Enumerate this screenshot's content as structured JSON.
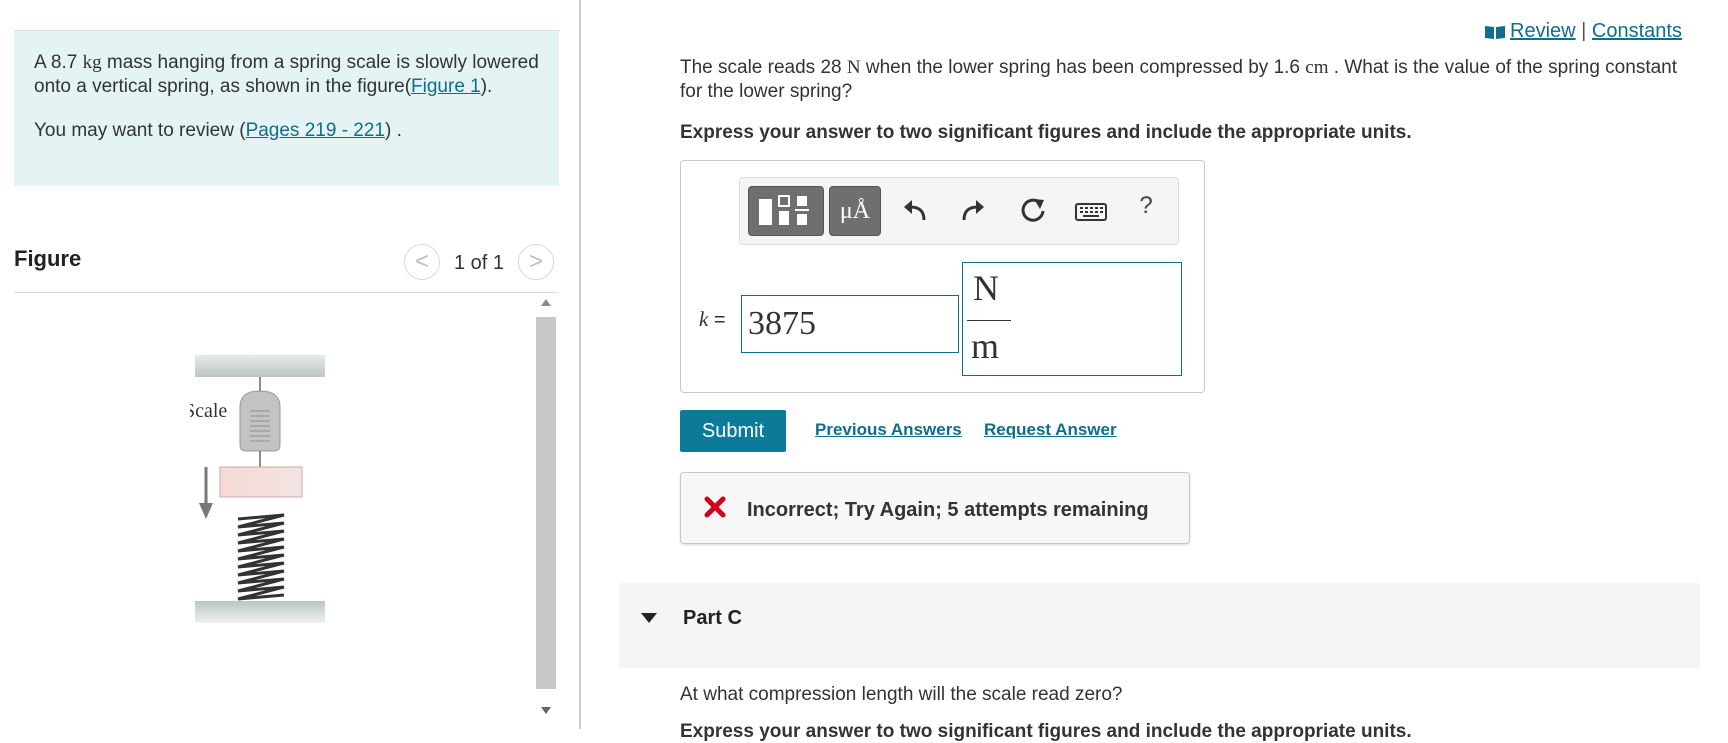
{
  "intro": {
    "text_before": "A 8.7 ",
    "mass_unit": "kg",
    "text_after": " mass hanging from a spring scale is slowly lowered onto a vertical spring, as shown in the figure(",
    "figure_link": "Figure 1",
    "close": ").",
    "review_before": "You may want to review (",
    "pages_link": "Pages 219 - 221",
    "review_after": ") ."
  },
  "figure": {
    "title": "Figure",
    "prev": "<",
    "counter": "1 of 1",
    "next": ">",
    "scale_label": "Scale",
    "icon": "spring-scale-figure"
  },
  "header_links": {
    "review": "Review",
    "separator": "|",
    "constants": "Constants"
  },
  "question": {
    "before": "The scale reads 28 ",
    "force_unit": "N",
    "middle": " when the lower spring has been compressed by 1.6 ",
    "length_unit": "cm",
    "after": " . What is the value of the spring constant for the lower spring?",
    "instruction": "Express your answer to two significant figures and include the appropriate units."
  },
  "toolbar": {
    "templates_icon": "templates-icon",
    "units_label": "μÅ",
    "undo_icon": "undo-icon",
    "redo_icon": "redo-icon",
    "reset_icon": "reset-icon",
    "keyboard_icon": "keyboard-icon",
    "help_label": "?"
  },
  "answer": {
    "variable": "k",
    "equals": "=",
    "value": "3875",
    "unit_numerator": "N",
    "unit_denominator": "m"
  },
  "actions": {
    "submit": "Submit",
    "previous_answers": "Previous Answers",
    "request_answer": "Request Answer"
  },
  "feedback": {
    "text": "Incorrect; Try Again; 5 attempts remaining",
    "color": "#d0021b"
  },
  "part_c": {
    "title": "Part C",
    "question": "At what compression length will the scale read zero?",
    "instruction": "Express your answer to two significant figures and include the appropriate units."
  },
  "colors": {
    "accent": "#0c7b99",
    "link": "#0e6e8c",
    "intro_bg": "#e4f4f4"
  }
}
